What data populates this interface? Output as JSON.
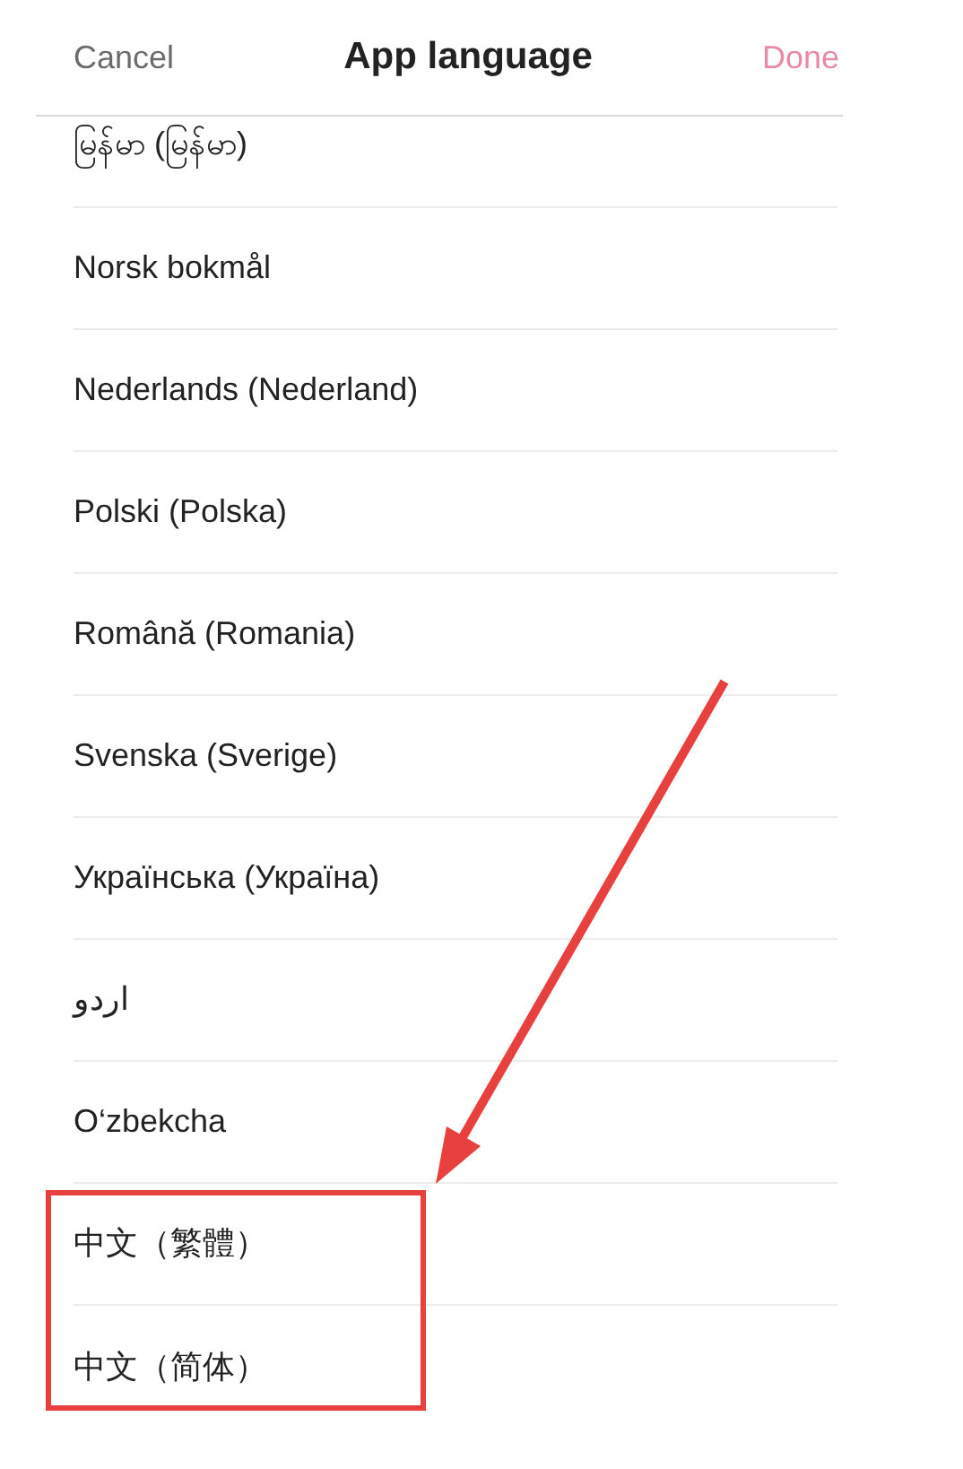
{
  "header": {
    "cancel": "Cancel",
    "title": "App language",
    "done": "Done",
    "done_disabled": true
  },
  "languages": [
    {
      "label": "မြန်မာ (မြန်မာ)"
    },
    {
      "label": "Norsk bokmål"
    },
    {
      "label": "Nederlands (Nederland)"
    },
    {
      "label": "Polski (Polska)"
    },
    {
      "label": "Română (Romania)"
    },
    {
      "label": "Svenska (Sverige)"
    },
    {
      "label": "Українська (Україна)"
    },
    {
      "label": "اردو"
    },
    {
      "label": "O‘zbekcha"
    },
    {
      "label": "中文（繁體）"
    },
    {
      "label": "中文（简体）"
    }
  ]
}
